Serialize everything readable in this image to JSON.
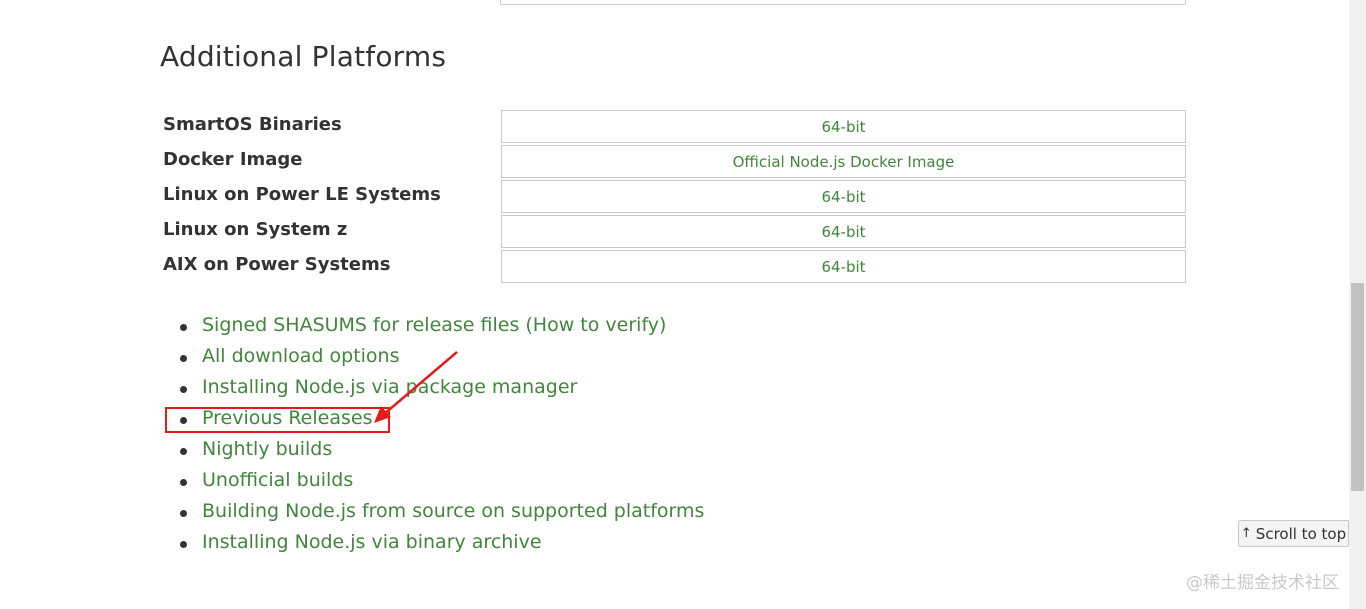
{
  "section": {
    "title": "Additional Platforms"
  },
  "platforms": [
    {
      "name": "SmartOS Binaries",
      "link": "64-bit"
    },
    {
      "name": "Docker Image",
      "link": "Official Node.js Docker Image"
    },
    {
      "name": "Linux on Power LE Systems",
      "link": "64-bit"
    },
    {
      "name": "Linux on System z",
      "link": "64-bit"
    },
    {
      "name": "AIX on Power Systems",
      "link": "64-bit"
    }
  ],
  "links": [
    "Signed SHASUMS for release files (How to verify)",
    "All download options",
    "Installing Node.js via package manager",
    "Previous Releases",
    "Nightly builds",
    "Unofficial builds",
    "Building Node.js from source on supported platforms",
    "Installing Node.js via binary archive"
  ],
  "scroll_top": {
    "icon": "arrow-up-icon",
    "label": "Scroll to top"
  },
  "watermark": "@稀土掘金技术社区",
  "colors": {
    "link": "#43853d",
    "annotation": "#e31b1b"
  }
}
